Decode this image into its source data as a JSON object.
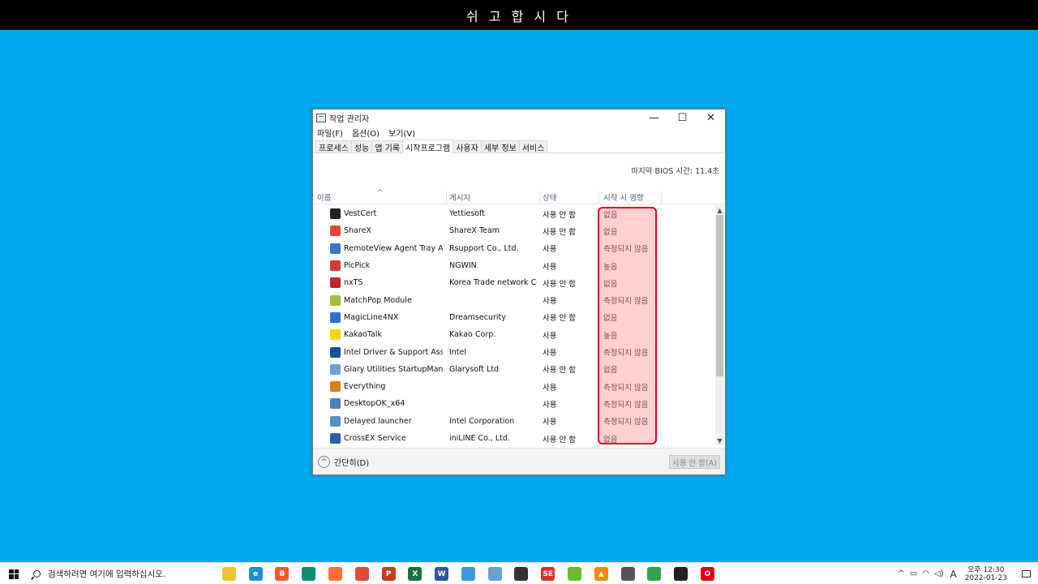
{
  "banner": {
    "text": "쉬 고 합 시 다"
  },
  "window": {
    "title": "작업 관리자",
    "controls": {
      "minimize": "—",
      "maximize": "☐",
      "close": "✕"
    }
  },
  "menu": [
    "파일(F)",
    "옵션(O)",
    "보기(V)"
  ],
  "tabs": [
    {
      "label": "프로세스",
      "active": false
    },
    {
      "label": "성능",
      "active": false
    },
    {
      "label": "앱 기록",
      "active": false
    },
    {
      "label": "시작프로그램",
      "active": true
    },
    {
      "label": "사용자",
      "active": false
    },
    {
      "label": "세부 정보",
      "active": false
    },
    {
      "label": "서비스",
      "active": false
    }
  ],
  "bios_info": "마지막 BIOS 시간:  11.4초",
  "columns": {
    "name": "이름",
    "publisher": "게시자",
    "status": "상태",
    "impact": "시작 시 영향"
  },
  "rows": [
    {
      "name": "VestCert",
      "publisher": "Yettiesoft",
      "status": "사용 안 함",
      "impact": "없음",
      "icon": "vestcert-icon",
      "color": "#222222"
    },
    {
      "name": "ShareX",
      "publisher": "ShareX Team",
      "status": "사용 안 함",
      "impact": "없음",
      "icon": "sharex-icon",
      "color": "#e8472d"
    },
    {
      "name": "RemoteView Agent Tray Ap...",
      "publisher": "Rsupport Co., Ltd.",
      "status": "사용",
      "impact": "측정되지 않음",
      "icon": "remoteview-icon",
      "color": "#3a78c9"
    },
    {
      "name": "PicPick",
      "publisher": "NGWIN",
      "status": "사용",
      "impact": "높음",
      "icon": "picpick-icon",
      "color": "#d23a3a"
    },
    {
      "name": "nxTS",
      "publisher": "Korea Trade network Co...",
      "status": "사용 안 함",
      "impact": "없음",
      "icon": "nxts-icon",
      "color": "#c02626"
    },
    {
      "name": "MatchPop Module",
      "publisher": "",
      "status": "사용",
      "impact": "측정되지 않음",
      "icon": "matchpop-icon",
      "color": "#9ac23c"
    },
    {
      "name": "MagicLine4NX",
      "publisher": "Dreamsecurity",
      "status": "사용 안 함",
      "impact": "없음",
      "icon": "magicline-icon",
      "color": "#2f6ed1"
    },
    {
      "name": "KakaoTalk",
      "publisher": "Kakao Corp.",
      "status": "사용",
      "impact": "높음",
      "icon": "kakaotalk-icon",
      "color": "#f7d600"
    },
    {
      "name": "Intel Driver & Support Assis...",
      "publisher": "Intel",
      "status": "사용",
      "impact": "측정되지 않음",
      "icon": "intel-icon",
      "color": "#1a4f9c"
    },
    {
      "name": "Glary Utilities StartupManag...",
      "publisher": "Glarysoft Ltd",
      "status": "사용 안 함",
      "impact": "없음",
      "icon": "glary-icon",
      "color": "#6aa3d8"
    },
    {
      "name": "Everything",
      "publisher": "",
      "status": "사용",
      "impact": "측정되지 않음",
      "icon": "everything-icon",
      "color": "#e07b1a"
    },
    {
      "name": "DesktopOK_x64",
      "publisher": "",
      "status": "사용",
      "impact": "측정되지 않음",
      "icon": "desktopok-icon",
      "color": "#4a7fc1"
    },
    {
      "name": "Delayed launcher",
      "publisher": "Intel Corporation",
      "status": "사용",
      "impact": "측정되지 않음",
      "icon": "delayed-launcher-icon",
      "color": "#5b8cc4"
    },
    {
      "name": "CrossEX Service",
      "publisher": "iniLINE Co., Ltd.",
      "status": "사용 안 함",
      "impact": "없음",
      "icon": "crossex-icon",
      "color": "#2d5fa8"
    }
  ],
  "footer": {
    "collapse_label": "간단히(D)",
    "disable_label": "사용 안 함(A)"
  },
  "taskbar": {
    "search_placeholder": "검색하려면 여기에 입력하십시오.",
    "apps": [
      {
        "icon": "file-explorer-icon",
        "color": "#f2c232",
        "glyph": ""
      },
      {
        "icon": "edge-icon",
        "color": "#1c8fd6",
        "glyph": "e"
      },
      {
        "icon": "brave-icon",
        "color": "#fb542b",
        "glyph": "B"
      },
      {
        "icon": "app-green-icon",
        "color": "#0f8f6e",
        "glyph": ""
      },
      {
        "icon": "firefox-icon",
        "color": "#ff7139",
        "glyph": ""
      },
      {
        "icon": "chrome-icon",
        "color": "#dd4b39",
        "glyph": ""
      },
      {
        "icon": "powerpoint-icon",
        "color": "#c43e1c",
        "glyph": "P"
      },
      {
        "icon": "excel-icon",
        "color": "#1d6f42",
        "glyph": "X"
      },
      {
        "icon": "word-icon",
        "color": "#2b579a",
        "glyph": "W"
      },
      {
        "icon": "task-manager-icon",
        "color": "#3a9ad9",
        "glyph": ""
      },
      {
        "icon": "remote-desktop-icon",
        "color": "#6a9fd0",
        "glyph": ""
      },
      {
        "icon": "search-app-icon",
        "color": "#333333",
        "glyph": ""
      },
      {
        "icon": "se-icon",
        "color": "#d8312a",
        "glyph": "SE"
      },
      {
        "icon": "app-lime-icon",
        "color": "#6bbf2a",
        "glyph": ""
      },
      {
        "icon": "vlc-icon",
        "color": "#f08a00",
        "glyph": "▲"
      },
      {
        "icon": "calculator-icon",
        "color": "#555555",
        "glyph": ""
      },
      {
        "icon": "chrome-alt-icon",
        "color": "#2ea44f",
        "glyph": ""
      },
      {
        "icon": "sticky-notes-icon",
        "color": "#222222",
        "glyph": ""
      },
      {
        "icon": "opera-icon",
        "color": "#e0001b",
        "glyph": "O"
      }
    ],
    "tray": {
      "chevron": "^",
      "ime": "A",
      "time": "오후 12:30",
      "date": "2022-01-23"
    }
  }
}
